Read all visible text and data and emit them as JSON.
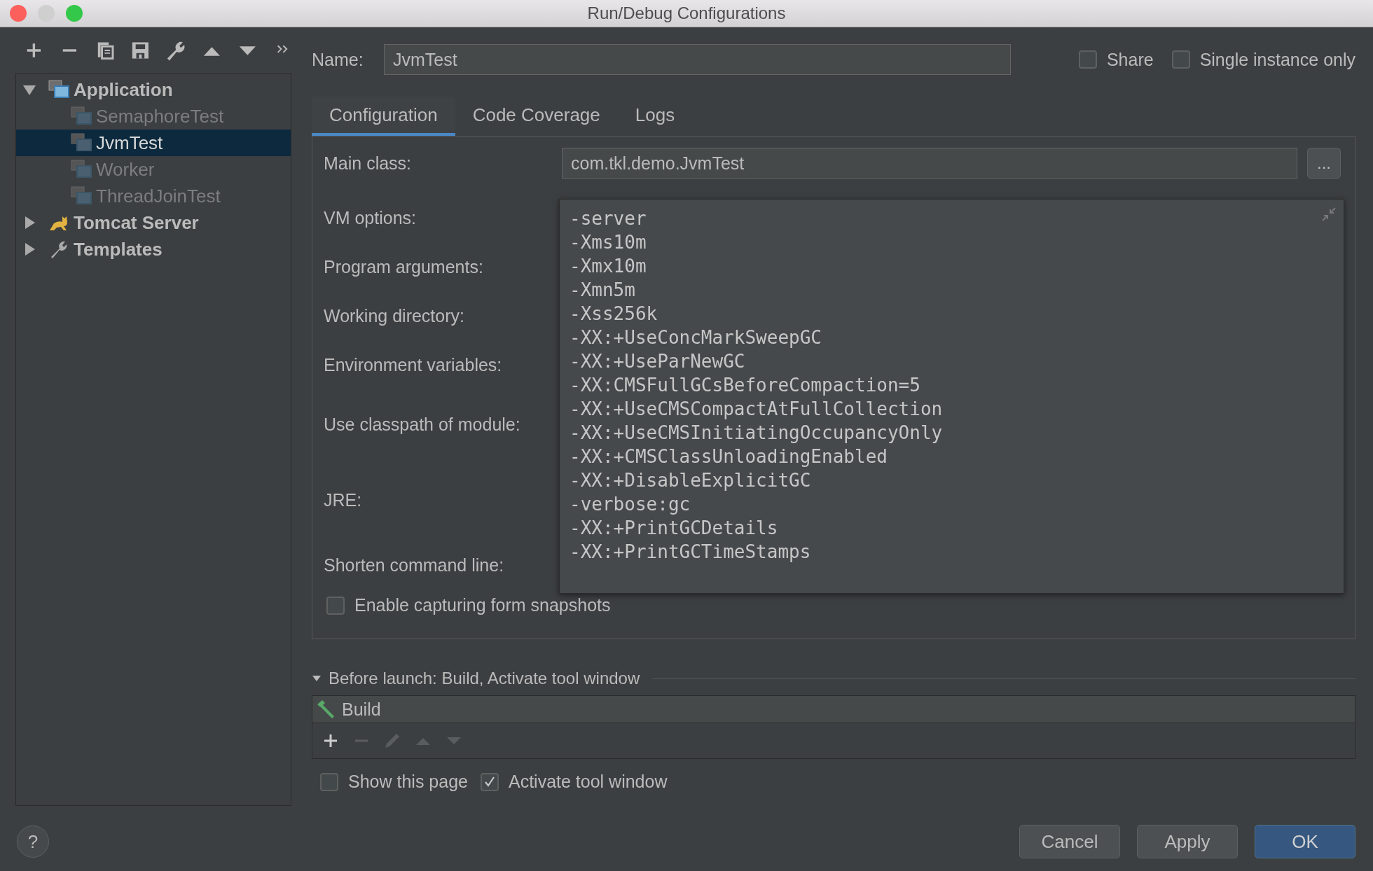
{
  "window": {
    "title": "Run/Debug Configurations"
  },
  "tree": [
    {
      "label": "Application",
      "kind": "application",
      "expanded": true,
      "children": [
        {
          "label": "SemaphoreTest",
          "selected": false,
          "dimmed": true
        },
        {
          "label": "JvmTest",
          "selected": true,
          "dimmed": false
        },
        {
          "label": "Worker",
          "selected": false,
          "dimmed": true
        },
        {
          "label": "ThreadJoinTest",
          "selected": false,
          "dimmed": true
        }
      ]
    },
    {
      "label": "Tomcat Server",
      "kind": "tomcat",
      "expanded": false
    },
    {
      "label": "Templates",
      "kind": "templates",
      "expanded": false
    }
  ],
  "name_field": {
    "label": "Name:",
    "value": "JvmTest"
  },
  "header_options": [
    {
      "label": "Share",
      "checked": false
    },
    {
      "label": "Single instance only",
      "checked": false
    }
  ],
  "tabs": [
    {
      "label": "Configuration",
      "selected": true
    },
    {
      "label": "Code Coverage",
      "selected": false
    },
    {
      "label": "Logs",
      "selected": false
    }
  ],
  "main_class": {
    "label": "Main class:",
    "value": "com.tkl.demo.JvmTest",
    "button": "..."
  },
  "field_labels": [
    "VM options:",
    "Program arguments:",
    "Working directory:",
    "Environment variables:",
    "Use classpath of module:",
    "JRE:",
    "Shorten command line:"
  ],
  "vm_options_editor": {
    "lines": [
      "-server",
      "-Xms10m",
      "-Xmx10m",
      "-Xmn5m",
      "-Xss256k",
      "-XX:+UseConcMarkSweepGC",
      "-XX:+UseParNewGC",
      "-XX:CMSFullGCsBeforeCompaction=5",
      "-XX:+UseCMSCompactAtFullCollection",
      "-XX:+UseCMSInitiatingOccupancyOnly",
      "-XX:+CMSClassUnloadingEnabled",
      "-XX:+DisableExplicitGC",
      "-verbose:gc",
      "-XX:+PrintGCDetails",
      "-XX:+PrintGCTimeStamps"
    ]
  },
  "snapshot_option": {
    "label": "Enable capturing form snapshots",
    "checked": false
  },
  "before_launch": {
    "title": "Before launch: Build, Activate tool window",
    "expanded": true,
    "tasks": [
      {
        "label": "Build"
      }
    ]
  },
  "launch_options": [
    {
      "label": "Show this page",
      "checked": false
    },
    {
      "label": "Activate tool window",
      "checked": true
    }
  ],
  "help": "?",
  "buttons": [
    {
      "label": "Cancel",
      "kind": "normal"
    },
    {
      "label": "Apply",
      "kind": "normal"
    },
    {
      "label": "OK",
      "kind": "default"
    }
  ]
}
